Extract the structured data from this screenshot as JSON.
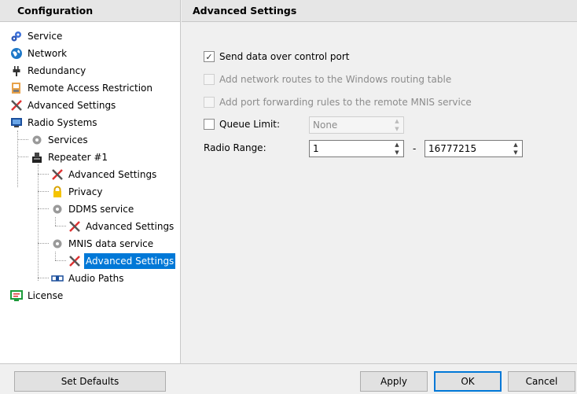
{
  "left": {
    "header": "Configuration",
    "tree": [
      {
        "label": "Service",
        "icon": "service-gears-icon"
      },
      {
        "label": "Network",
        "icon": "network-globe-icon"
      },
      {
        "label": "Redundancy",
        "icon": "power-plug-icon"
      },
      {
        "label": "Remote Access Restriction",
        "icon": "remote-access-icon"
      },
      {
        "label": "Advanced Settings",
        "icon": "tools-icon"
      },
      {
        "label": "Radio Systems",
        "icon": "radio-systems-icon"
      },
      {
        "label": "Services",
        "icon": "gear-icon"
      },
      {
        "label": "Repeater #1",
        "icon": "repeater-icon"
      },
      {
        "label": "Advanced Settings",
        "icon": "tools-icon"
      },
      {
        "label": "Privacy",
        "icon": "lock-icon"
      },
      {
        "label": "DDMS service",
        "icon": "gear-icon"
      },
      {
        "label": "Advanced Settings",
        "icon": "tools-icon"
      },
      {
        "label": "MNIS data service",
        "icon": "gear-icon"
      },
      {
        "label": "Advanced Settings",
        "icon": "tools-icon"
      },
      {
        "label": "Audio Paths",
        "icon": "audio-paths-icon"
      },
      {
        "label": "License",
        "icon": "license-icon"
      }
    ]
  },
  "right": {
    "header": "Advanced Settings",
    "send_data": {
      "label": "Send data over control port",
      "checked": true
    },
    "add_routes": {
      "label": "Add network routes to the Windows routing table",
      "checked": false,
      "enabled": false
    },
    "port_forwarding": {
      "label": "Add port forwarding rules to the remote MNIS service",
      "checked": false,
      "enabled": false
    },
    "queue_limit": {
      "label": "Queue Limit:",
      "value": "None",
      "checked": false
    },
    "radio_range": {
      "label": "Radio Range:",
      "from": "1",
      "separator": "-",
      "to": "16777215"
    }
  },
  "buttons": {
    "set_defaults": "Set Defaults",
    "apply": "Apply",
    "ok": "OK",
    "cancel": "Cancel"
  },
  "colors": {
    "selection": "#0078d7"
  }
}
